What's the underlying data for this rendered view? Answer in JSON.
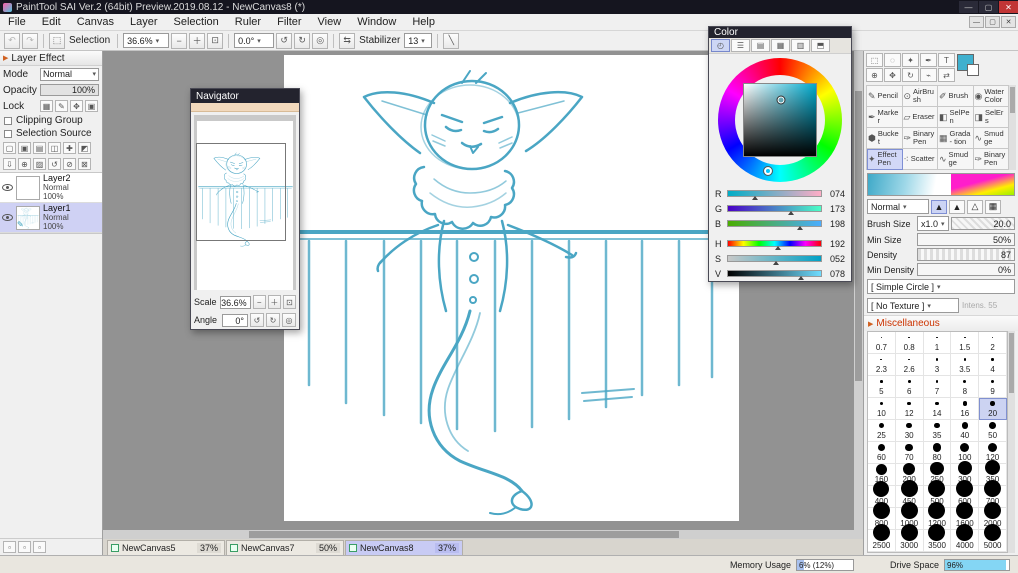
{
  "window": {
    "title": "PaintTool SAI Ver.2 (64bit) Preview.2019.08.12 - NewCanvas8 (*)",
    "icons": {
      "minimize": "—",
      "maximize": "▢",
      "close": "✕"
    }
  },
  "menu": [
    "File",
    "Edit",
    "Canvas",
    "Layer",
    "Selection",
    "Ruler",
    "Filter",
    "View",
    "Window",
    "Help"
  ],
  "toolbar": {
    "selection_label": "Selection",
    "zoom": "36.6%",
    "angle": "0.0°",
    "stabilizer_label": "Stabilizer",
    "stabilizer_value": "13",
    "icons": {
      "undo": "↶",
      "redo": "↷",
      "selection": "⬚",
      "zoom_out": "−",
      "zoom_in": "＋",
      "zoom_fit": "⊡",
      "rotate_ccw": "↺",
      "rotate_cw": "↻",
      "rotate_reset": "◎",
      "flip": "⇆",
      "pen_stroke": "╲"
    }
  },
  "left_panel": {
    "header": "Layer Effect",
    "header_marker": "▶",
    "mode_label": "Mode",
    "mode_value": "Normal",
    "opacity_label": "Opacity",
    "opacity_value": "100%",
    "lock_label": "Lock",
    "lock_icons": [
      {
        "name": "lock-transparency-icon",
        "icon": "▦"
      },
      {
        "name": "lock-pixels-icon",
        "icon": "✎"
      },
      {
        "name": "lock-position-icon",
        "icon": "✥"
      },
      {
        "name": "lock-all-icon",
        "icon": "▣"
      }
    ],
    "clipping_label": "Clipping Group",
    "selection_source_label": "Selection Source",
    "layer_buttons_row1": [
      {
        "name": "new-layer-button",
        "icon": "▢"
      },
      {
        "name": "new-linework-layer-button",
        "icon": "▣"
      },
      {
        "name": "new-folder-button",
        "icon": "▤"
      },
      {
        "name": "duplicate-layer-button",
        "icon": "◫"
      },
      {
        "name": "add-mask-button",
        "icon": "✚"
      },
      {
        "name": "special-layer-button",
        "icon": "◩"
      }
    ],
    "layer_buttons_row2": [
      {
        "name": "transfer-down-button",
        "icon": "⇩"
      },
      {
        "name": "merge-down-button",
        "icon": "⊕"
      },
      {
        "name": "fill-layer-button",
        "icon": "▨"
      },
      {
        "name": "rotate-layer-button",
        "icon": "↺"
      },
      {
        "name": "clear-layer-button",
        "icon": "⊘"
      },
      {
        "name": "delete-layer-button",
        "icon": "⊠"
      }
    ],
    "layers": [
      {
        "name": "Layer2",
        "mode": "Normal",
        "opacity": "100%"
      },
      {
        "name": "Layer1",
        "mode": "Normal",
        "opacity": "100%"
      }
    ],
    "bottom_icons": [
      {
        "name": "panel-option-1-button",
        "icon": "▫"
      },
      {
        "name": "panel-option-2-button",
        "icon": "▫"
      },
      {
        "name": "panel-option-3-button",
        "icon": "▫"
      }
    ],
    "pen_badge": "✎"
  },
  "navigator": {
    "title": "Navigator",
    "scale_label": "Scale",
    "scale_value": "36.6%",
    "angle_label": "Angle",
    "angle_value": "0°",
    "icons": {
      "zoom_out": "−",
      "zoom_in": "＋",
      "zoom_fit": "⊡",
      "rotate_ccw": "↺",
      "rotate_cw": "↻",
      "rotate_reset": "◎"
    }
  },
  "color_panel": {
    "title": "Color",
    "tabs": [
      {
        "name": "color-wheel-tab",
        "icon": "◴",
        "active": true
      },
      {
        "name": "rgb-slider-tab",
        "icon": "☰",
        "active": false
      },
      {
        "name": "hsv-slider-tab",
        "icon": "▤",
        "active": false
      },
      {
        "name": "color-mixer-tab",
        "icon": "▦",
        "active": false
      },
      {
        "name": "swatches-tab",
        "icon": "▥",
        "active": false
      },
      {
        "name": "scratchpad-tab",
        "icon": "⬒",
        "active": false
      }
    ],
    "sliders": [
      {
        "ch": "R",
        "display": "074",
        "value": 74,
        "max": 255
      },
      {
        "ch": "G",
        "display": "173",
        "value": 173,
        "max": 255
      },
      {
        "ch": "B",
        "display": "198",
        "value": 198,
        "max": 255
      },
      {
        "ch": "H",
        "display": "192",
        "value": 192,
        "max": 360
      },
      {
        "ch": "S",
        "display": "052",
        "value": 52,
        "max": 100
      },
      {
        "ch": "V",
        "display": "078",
        "value": 78,
        "max": 100
      }
    ]
  },
  "right_panel": {
    "top_icons": [
      {
        "name": "rect-select-icon",
        "icon": "⬚"
      },
      {
        "name": "lasso-icon",
        "icon": "◌"
      },
      {
        "name": "magic-wand-icon",
        "icon": "✦"
      },
      {
        "name": "pen-cursor-icon",
        "icon": "✒"
      },
      {
        "name": "text-tool-icon",
        "icon": "T"
      },
      {
        "name": "zoom-tool-icon",
        "icon": "⊕"
      },
      {
        "name": "hand-tool-icon",
        "icon": "✥"
      },
      {
        "name": "rotate-view-icon",
        "icon": "↻"
      },
      {
        "name": "eyedropper-icon",
        "icon": "⌁"
      },
      {
        "name": "swap-color-icon",
        "icon": "⇄"
      }
    ],
    "foreground_color": "#3fb0ce",
    "background_color": "#ffffff"
  },
  "tools": {
    "items": [
      {
        "label": "Pencil",
        "icon": "✎",
        "selected": false
      },
      {
        "label": "AirBrush",
        "icon": "⊙",
        "selected": false
      },
      {
        "label": "Brush",
        "icon": "✐",
        "selected": false
      },
      {
        "label": "Water Color",
        "icon": "◉",
        "selected": false
      },
      {
        "label": "Marker",
        "icon": "✒",
        "selected": false
      },
      {
        "label": "Eraser",
        "icon": "▱",
        "selected": false
      },
      {
        "label": "SelPen",
        "icon": "◧",
        "selected": false
      },
      {
        "label": "SelErs",
        "icon": "◨",
        "selected": false
      },
      {
        "label": "Bucket",
        "icon": "⬢",
        "selected": false
      },
      {
        "label": "Binary Pen",
        "icon": "✑",
        "selected": false
      },
      {
        "label": "Grada- tion",
        "icon": "▦",
        "selected": false
      },
      {
        "label": "Smudge",
        "icon": "∿",
        "selected": false
      },
      {
        "label": "Effect Pen",
        "icon": "✦",
        "selected": true
      },
      {
        "label": "Scatter",
        "icon": "⁖",
        "selected": false
      },
      {
        "label": "Smudge",
        "icon": "∿",
        "selected": false
      },
      {
        "label": "Binary Pen",
        "icon": "✑",
        "selected": false
      }
    ]
  },
  "brush": {
    "blend": "Normal",
    "tip_icons": [
      {
        "name": "brush-tip-hard",
        "icon": "▲",
        "active": true
      },
      {
        "name": "brush-tip-medium",
        "icon": "▲",
        "active": false
      },
      {
        "name": "brush-tip-soft",
        "icon": "△",
        "active": false
      },
      {
        "name": "brush-tip-texture",
        "icon": "▦",
        "active": false
      }
    ],
    "size_label": "Brush Size",
    "size_scale": "x1.0",
    "size_value": "20.0",
    "min_size_label": "Min Size",
    "min_size_value": "50%",
    "density_label": "Density",
    "density_value": "87",
    "min_density_label": "Min Density",
    "min_density_value": "0%",
    "shape_value": "[ Simple Circle ]",
    "texture_value": "[ No Texture ]",
    "texture_intensity": "Intens. 55",
    "misc_header": "Miscellaneous",
    "misc_marker": "▶"
  },
  "brush_sizes": {
    "values": [
      0.7,
      0.8,
      1,
      1.5,
      2,
      2.3,
      2.6,
      3,
      3.5,
      4,
      5,
      6,
      7,
      8,
      9,
      10,
      12,
      14,
      16,
      20,
      25,
      30,
      35,
      40,
      50,
      60,
      70,
      80,
      100,
      120,
      160,
      200,
      250,
      300,
      350,
      400,
      450,
      500,
      600,
      700,
      800,
      1000,
      1200,
      1600,
      2000,
      2500,
      3000,
      3500,
      4000,
      5000
    ],
    "selected": 20
  },
  "tabs": [
    {
      "name": "NewCanvas5",
      "zoom": "37%"
    },
    {
      "name": "NewCanvas7",
      "zoom": "50%"
    },
    {
      "name": "NewCanvas8",
      "zoom": "37%"
    }
  ],
  "status": {
    "memory_label": "Memory Usage",
    "memory_value": "6% (12%)",
    "drive_label": "Drive Space",
    "drive_value": "96%"
  },
  "colors": {
    "sketch": "#4aa6c4",
    "selection_highlight": "#cfd1f4",
    "active_tab": "#c8cbf4"
  }
}
